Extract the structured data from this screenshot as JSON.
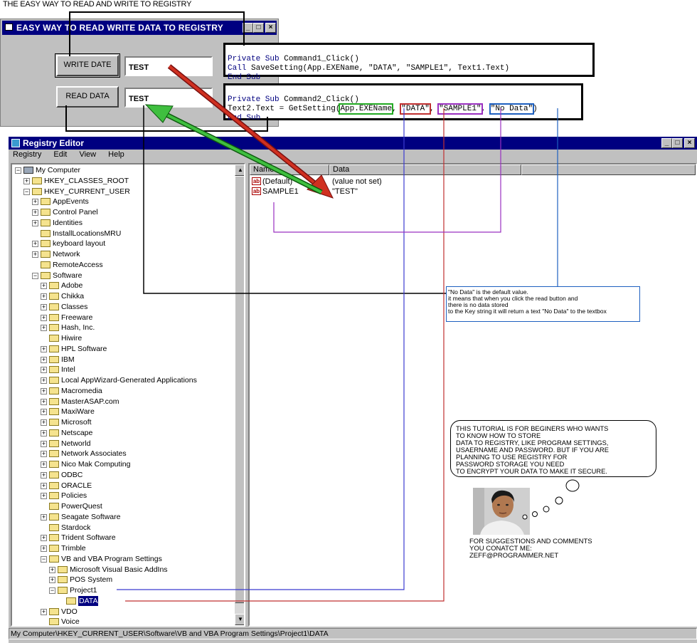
{
  "page_title": "THE EASY WAY TO READ AND WRITE TO REGISTRY",
  "vb_form": {
    "title": "EASY WAY TO READ WRITE DATA TO REGISTRY",
    "write_button": "WRITE DATE",
    "read_button": "READ DATA",
    "text1_value": "TEST",
    "text2_value": "TEST"
  },
  "code": {
    "block1": {
      "line1_kw": "Private Sub",
      "line1_rest": " Command1_Click()",
      "line2_kw": "Call",
      "line2_rest": " SaveSetting(App.EXEName, \"DATA\", \"SAMPLE1\", Text1.Text)",
      "line3": "End Sub"
    },
    "block2": {
      "line1_kw": "Private Sub",
      "line1_rest": " Command2_Click()",
      "line2_prefix": "Text2.Text = GetSetting(",
      "arg1": "App.EXEName",
      "arg2": "\"DATA\"",
      "arg3": "\"SAMPLE1\"",
      "arg4": "\"No Data\"",
      "sep": ",",
      "close": ")",
      "line3": "End Sub"
    }
  },
  "registry_editor": {
    "title": "Registry Editor",
    "menu": [
      "Registry",
      "Edit",
      "View",
      "Help"
    ],
    "tree": [
      {
        "label": "My Computer",
        "level": 0,
        "sign": "-"
      },
      {
        "label": "HKEY_CLASSES_ROOT",
        "level": 1,
        "sign": "+"
      },
      {
        "label": "HKEY_CURRENT_USER",
        "level": 1,
        "sign": "-"
      },
      {
        "label": "AppEvents",
        "level": 2,
        "sign": "+"
      },
      {
        "label": "Control Panel",
        "level": 2,
        "sign": "+"
      },
      {
        "label": "Identities",
        "level": 2,
        "sign": "+"
      },
      {
        "label": "InstallLocationsMRU",
        "level": 2,
        "sign": ""
      },
      {
        "label": "keyboard layout",
        "level": 2,
        "sign": "+"
      },
      {
        "label": "Network",
        "level": 2,
        "sign": "+"
      },
      {
        "label": "RemoteAccess",
        "level": 2,
        "sign": ""
      },
      {
        "label": "Software",
        "level": 2,
        "sign": "-"
      },
      {
        "label": "Adobe",
        "level": 3,
        "sign": "+"
      },
      {
        "label": "Chikka",
        "level": 3,
        "sign": "+"
      },
      {
        "label": "Classes",
        "level": 3,
        "sign": "+"
      },
      {
        "label": "Freeware",
        "level": 3,
        "sign": "+"
      },
      {
        "label": "Hash, Inc.",
        "level": 3,
        "sign": "+"
      },
      {
        "label": "Hiwire",
        "level": 3,
        "sign": ""
      },
      {
        "label": "HPL Software",
        "level": 3,
        "sign": "+"
      },
      {
        "label": "IBM",
        "level": 3,
        "sign": "+"
      },
      {
        "label": "Intel",
        "level": 3,
        "sign": "+"
      },
      {
        "label": "Local AppWizard-Generated Applications",
        "level": 3,
        "sign": "+"
      },
      {
        "label": "Macromedia",
        "level": 3,
        "sign": "+"
      },
      {
        "label": "MasterASAP.com",
        "level": 3,
        "sign": "+"
      },
      {
        "label": "MaxiWare",
        "level": 3,
        "sign": "+"
      },
      {
        "label": "Microsoft",
        "level": 3,
        "sign": "+"
      },
      {
        "label": "Netscape",
        "level": 3,
        "sign": "+"
      },
      {
        "label": "Networld",
        "level": 3,
        "sign": "+"
      },
      {
        "label": "Network Associates",
        "level": 3,
        "sign": "+"
      },
      {
        "label": "Nico Mak Computing",
        "level": 3,
        "sign": "+"
      },
      {
        "label": "ODBC",
        "level": 3,
        "sign": "+"
      },
      {
        "label": "ORACLE",
        "level": 3,
        "sign": "+"
      },
      {
        "label": "Policies",
        "level": 3,
        "sign": "+"
      },
      {
        "label": "PowerQuest",
        "level": 3,
        "sign": ""
      },
      {
        "label": "Seagate Software",
        "level": 3,
        "sign": "+"
      },
      {
        "label": "Stardock",
        "level": 3,
        "sign": ""
      },
      {
        "label": "Trident Software",
        "level": 3,
        "sign": "+"
      },
      {
        "label": "Trimble",
        "level": 3,
        "sign": "+"
      },
      {
        "label": "VB and VBA Program Settings",
        "level": 3,
        "sign": "-"
      },
      {
        "label": "Microsoft Visual Basic AddIns",
        "level": 4,
        "sign": "+"
      },
      {
        "label": "POS System",
        "level": 4,
        "sign": "+"
      },
      {
        "label": "Project1",
        "level": 4,
        "sign": "-"
      },
      {
        "label": "DATA",
        "level": 5,
        "sign": "",
        "selected": true
      },
      {
        "label": "VDO",
        "level": 3,
        "sign": "+"
      },
      {
        "label": "Voice",
        "level": 3,
        "sign": ""
      }
    ],
    "columns": [
      "Name",
      "Data"
    ],
    "values": [
      {
        "name": "(Default)",
        "data": "(value not set)"
      },
      {
        "name": "SAMPLE1",
        "data": "\"TEST\""
      }
    ],
    "status": "My Computer\\HKEY_CURRENT_USER\\Software\\VB and VBA Program Settings\\Project1\\DATA"
  },
  "annotations": {
    "no_data_note": [
      "\"No Data\" is the default value.",
      "it means that when you click the read button and",
      "there is no data stored",
      " to the Key string it will return a text \"No Data\" to the textbox"
    ],
    "tutorial_bubble": [
      "THIS TUTORIAL IS FOR BEGINERS WHO WANTS",
      "TO KNOW HOW TO STORE",
      "DATA TO REGISTRY, LIKE PROGRAM SETTINGS,",
      "USAERNAME AND PASSWORD. BUT IF YOU ARE",
      "PLANNING TO USE REGISTRY FOR",
      " PASSWORD STORAGE YOU NEED",
      "TO ENCRYPT YOUR DATA TO MAKE IT SECURE."
    ],
    "contact": [
      "FOR SUGGESTIONS AND COMMENTS",
      "YOU CONATCT ME:",
      "ZEFF@PROGRAMMER.NET"
    ]
  },
  "colors": {
    "titlebar": "#000080",
    "arrow_red": "#b22222",
    "arrow_green": "#2e9e2e",
    "line_blue": "#3b3bd0",
    "line_red": "#c03030",
    "line_purple": "#9a30c0",
    "box_green": "#22aa22",
    "box_blue": "#1e60c0"
  }
}
